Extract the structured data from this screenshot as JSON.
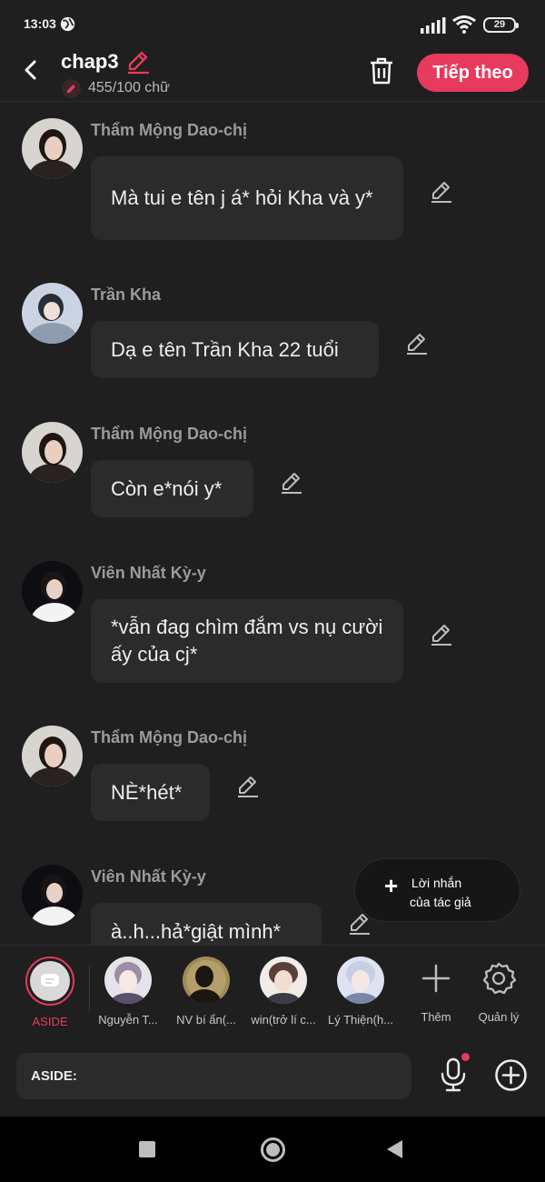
{
  "status_bar": {
    "time": "13:03",
    "battery": "29",
    "icons": [
      "browser-ball-icon",
      "signal-icon",
      "wifi-icon",
      "battery-icon"
    ]
  },
  "header": {
    "title": "chap3",
    "word_count": "455/100 chữ",
    "next_label": "Tiếp theo",
    "icons": [
      "back-arrow-icon",
      "pencil-icon",
      "trash-icon"
    ],
    "accent_color": "#e63b5c"
  },
  "messages": [
    {
      "sender": "Thẩm Mộng Dao-chị",
      "text": "Mà tui e tên j á* hỏi Kha và y*"
    },
    {
      "sender": "Trần Kha",
      "text": "Dạ e tên Trần Kha 22 tuổi"
    },
    {
      "sender": "Thẩm Mộng Dao-chị",
      "text": "Còn e*nói y*"
    },
    {
      "sender": "Viên Nhất Kỳ-y",
      "text": "*vẫn đag chìm đắm vs nụ cười ấy của cj*"
    },
    {
      "sender": "Thẩm Mộng Dao-chị",
      "text": "NÈ*hét*"
    },
    {
      "sender": "Viên Nhất Kỳ-y",
      "text": "à..h...hả*giật mình*"
    }
  ],
  "author_note": {
    "line1": "Lời nhắn",
    "line2": "của tác giả"
  },
  "character_bar": {
    "characters": [
      {
        "label": "ASIDE"
      },
      {
        "label": "Nguyễn T..."
      },
      {
        "label": "NV bí ẩn(..."
      },
      {
        "label": "win(trở lí c..."
      },
      {
        "label": "Lý Thiện(h..."
      }
    ],
    "more_label": "Thêm",
    "manage_label": "Quản lý"
  },
  "composer": {
    "placeholder": "ASIDE:"
  }
}
